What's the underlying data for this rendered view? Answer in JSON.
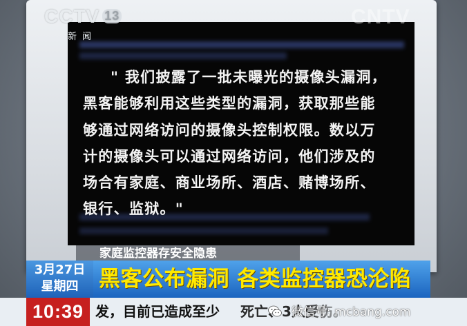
{
  "channel": {
    "logo": "CCTV",
    "number": "13",
    "sub": "新闻",
    "watermark": "CNTV"
  },
  "screen": {
    "quote_lines": [
      "\" 我们披露了一批未曝光的摄像头漏洞，",
      "黑客能够利用这些类型的漏洞，获取那些能",
      "够通过网络访问的摄像头控制权限。数以万",
      "计的摄像头可以通过网络访问，他们涉及的",
      "场合有家庭、商业场所、酒店、赌博场所、",
      "银行、监狱。\""
    ]
  },
  "sub_caption": "家庭监控器存安全隐患",
  "banner": {
    "date": "3月27日",
    "weekday": "星期四",
    "headline": "黑客公布漏洞 各类监控器恐沦陷"
  },
  "ticker": {
    "time": "10:39",
    "text": "发，目前已造成至少",
    "text_tail": "死亡、3人受伤。"
  },
  "overlay": {
    "wechat_label": "微信号: mcbang.com",
    "wechat_icon": "wechat-icon"
  }
}
